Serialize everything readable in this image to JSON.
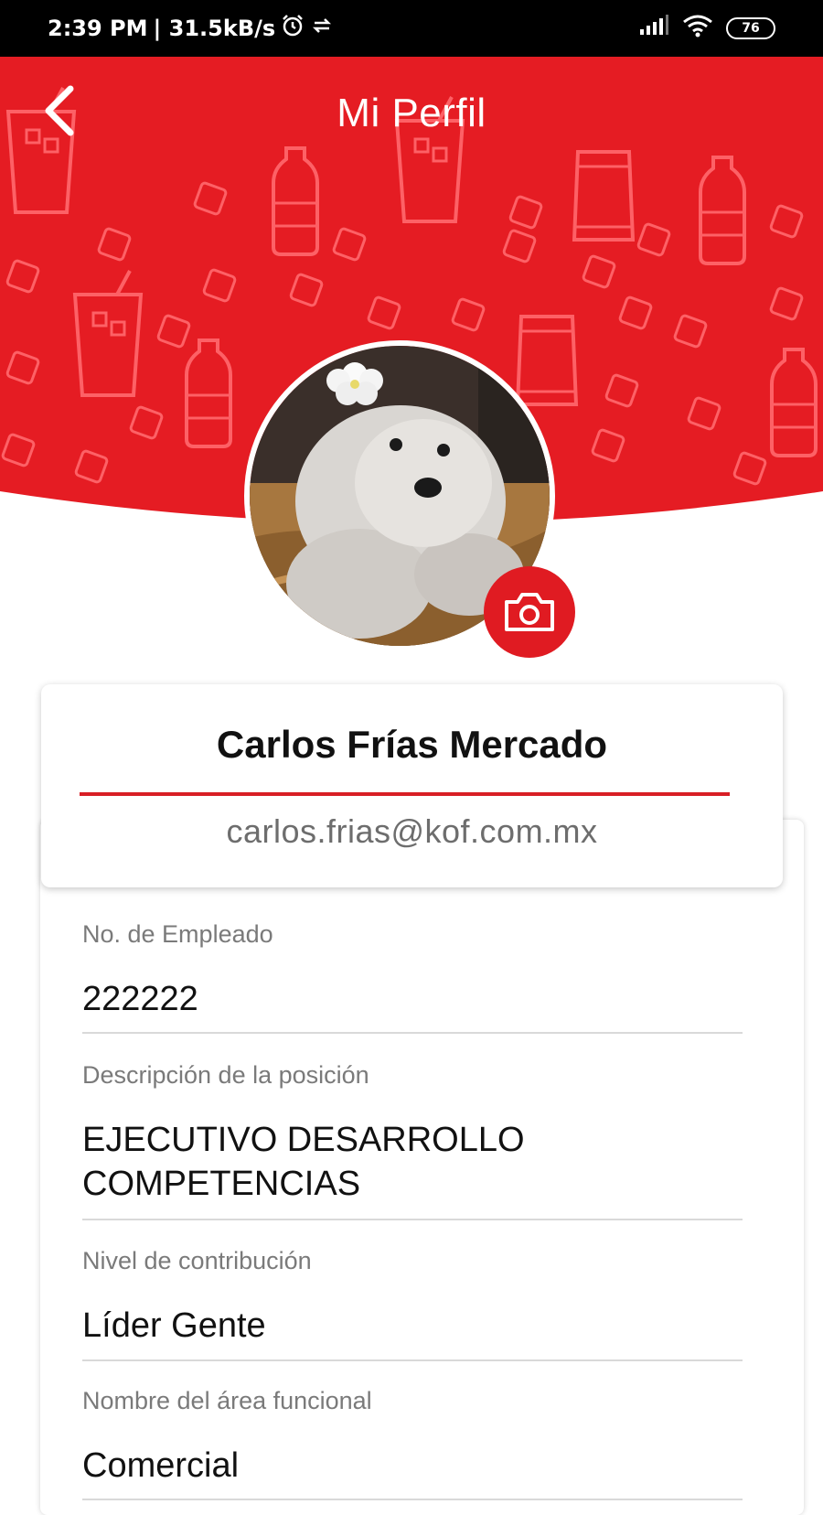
{
  "status_bar": {
    "time": "2:39 PM",
    "network_speed": "| 31.5kB/s",
    "battery": "76",
    "icons": [
      "alarm-icon",
      "sync-icon",
      "signal-icon",
      "wifi-icon",
      "battery-icon"
    ]
  },
  "app_bar": {
    "title": "Mi Perfil",
    "back_icon": "chevron-left-icon"
  },
  "profile": {
    "name": "Carlos Frías Mercado",
    "email": "carlos.frias@kof.com.mx",
    "camera_icon": "camera-icon"
  },
  "fields": [
    {
      "label": "No. de Empleado",
      "value": "222222"
    },
    {
      "label": "Descripción de la posición",
      "value_line1": "EJECUTIVO DESARROLLO",
      "value_line2": "COMPETENCIAS"
    },
    {
      "label": "Nivel de contribución",
      "value": "Líder Gente"
    },
    {
      "label": "Nombre del área funcional",
      "value": "Comercial"
    }
  ],
  "colors": {
    "brand_red": "#e51c23",
    "accent_line": "#d81e25",
    "status_bar": "#000000"
  }
}
